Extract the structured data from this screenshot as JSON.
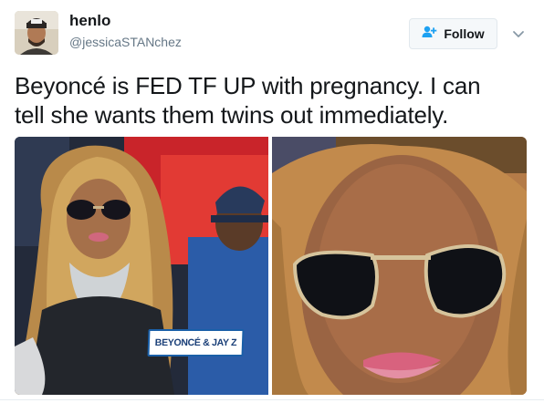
{
  "tweet": {
    "author": {
      "display_name": "henlo",
      "handle": "@jessicaSTANchez",
      "avatar_icon": "profile-photo"
    },
    "follow_label": "Follow",
    "text": "Beyoncé is FED TF UP with pregnancy. I can\ntell she wants them twins out immediately.",
    "media": {
      "count": 2,
      "left_photo_caption": "BEYONCÉ & JAY Z"
    }
  },
  "colors": {
    "accent": "#1da1f2",
    "text": "#14171a",
    "secondary_text": "#657786",
    "button_bg": "#f5f8fa",
    "button_border": "#e1e8ed"
  },
  "icons": {
    "follow": "add-user-icon",
    "menu": "chevron-down-icon"
  }
}
